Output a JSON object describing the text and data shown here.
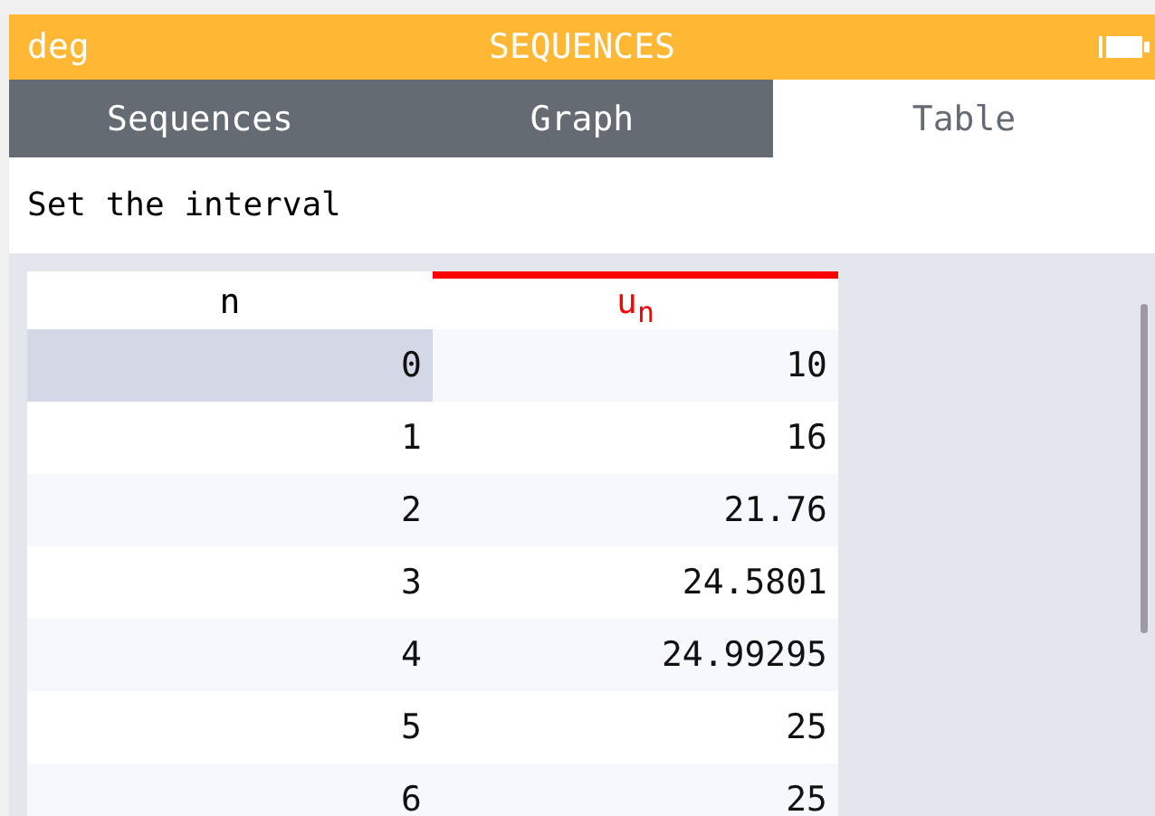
{
  "status_bar": {
    "angle_unit": "deg",
    "title": "SEQUENCES"
  },
  "tabs": [
    {
      "label": "Sequences",
      "selected": false
    },
    {
      "label": "Graph",
      "selected": false
    },
    {
      "label": "Table",
      "selected": true
    }
  ],
  "interval_button": {
    "label": "Set the interval"
  },
  "table": {
    "columns": [
      {
        "title": "n"
      },
      {
        "title": "u$_{n}$",
        "color": "#ff0000"
      }
    ],
    "rows": [
      {
        "n": "0",
        "value": "10",
        "selected": true
      },
      {
        "n": "1",
        "value": "16",
        "selected": false
      },
      {
        "n": "2",
        "value": "21.76",
        "selected": false
      },
      {
        "n": "3",
        "value": "24.5801",
        "selected": false
      },
      {
        "n": "4",
        "value": "24.99295",
        "selected": false
      },
      {
        "n": "5",
        "value": "25",
        "selected": false
      },
      {
        "n": "6",
        "value": "25",
        "selected": false
      }
    ]
  }
}
